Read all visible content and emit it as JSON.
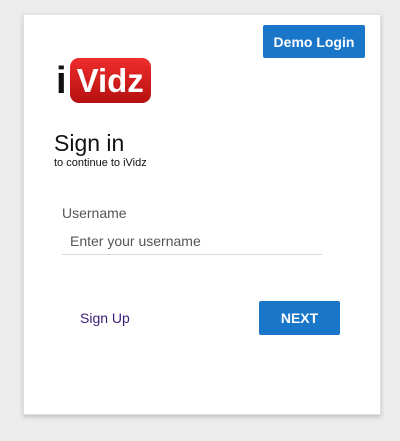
{
  "header": {
    "demo_login_label": "Demo Login"
  },
  "logo": {
    "prefix": "i",
    "word": "Vidz"
  },
  "signin": {
    "title": "Sign in",
    "subtitle": "to continue to iVidz"
  },
  "form": {
    "username_label": "Username",
    "username_value": "",
    "username_placeholder": "Enter your username"
  },
  "actions": {
    "signup_label": "Sign Up",
    "next_label": "NEXT"
  },
  "colors": {
    "accent": "#1976c9",
    "logo_red": "#d91f1f",
    "link": "#3a1d7a",
    "background": "#ececec"
  }
}
